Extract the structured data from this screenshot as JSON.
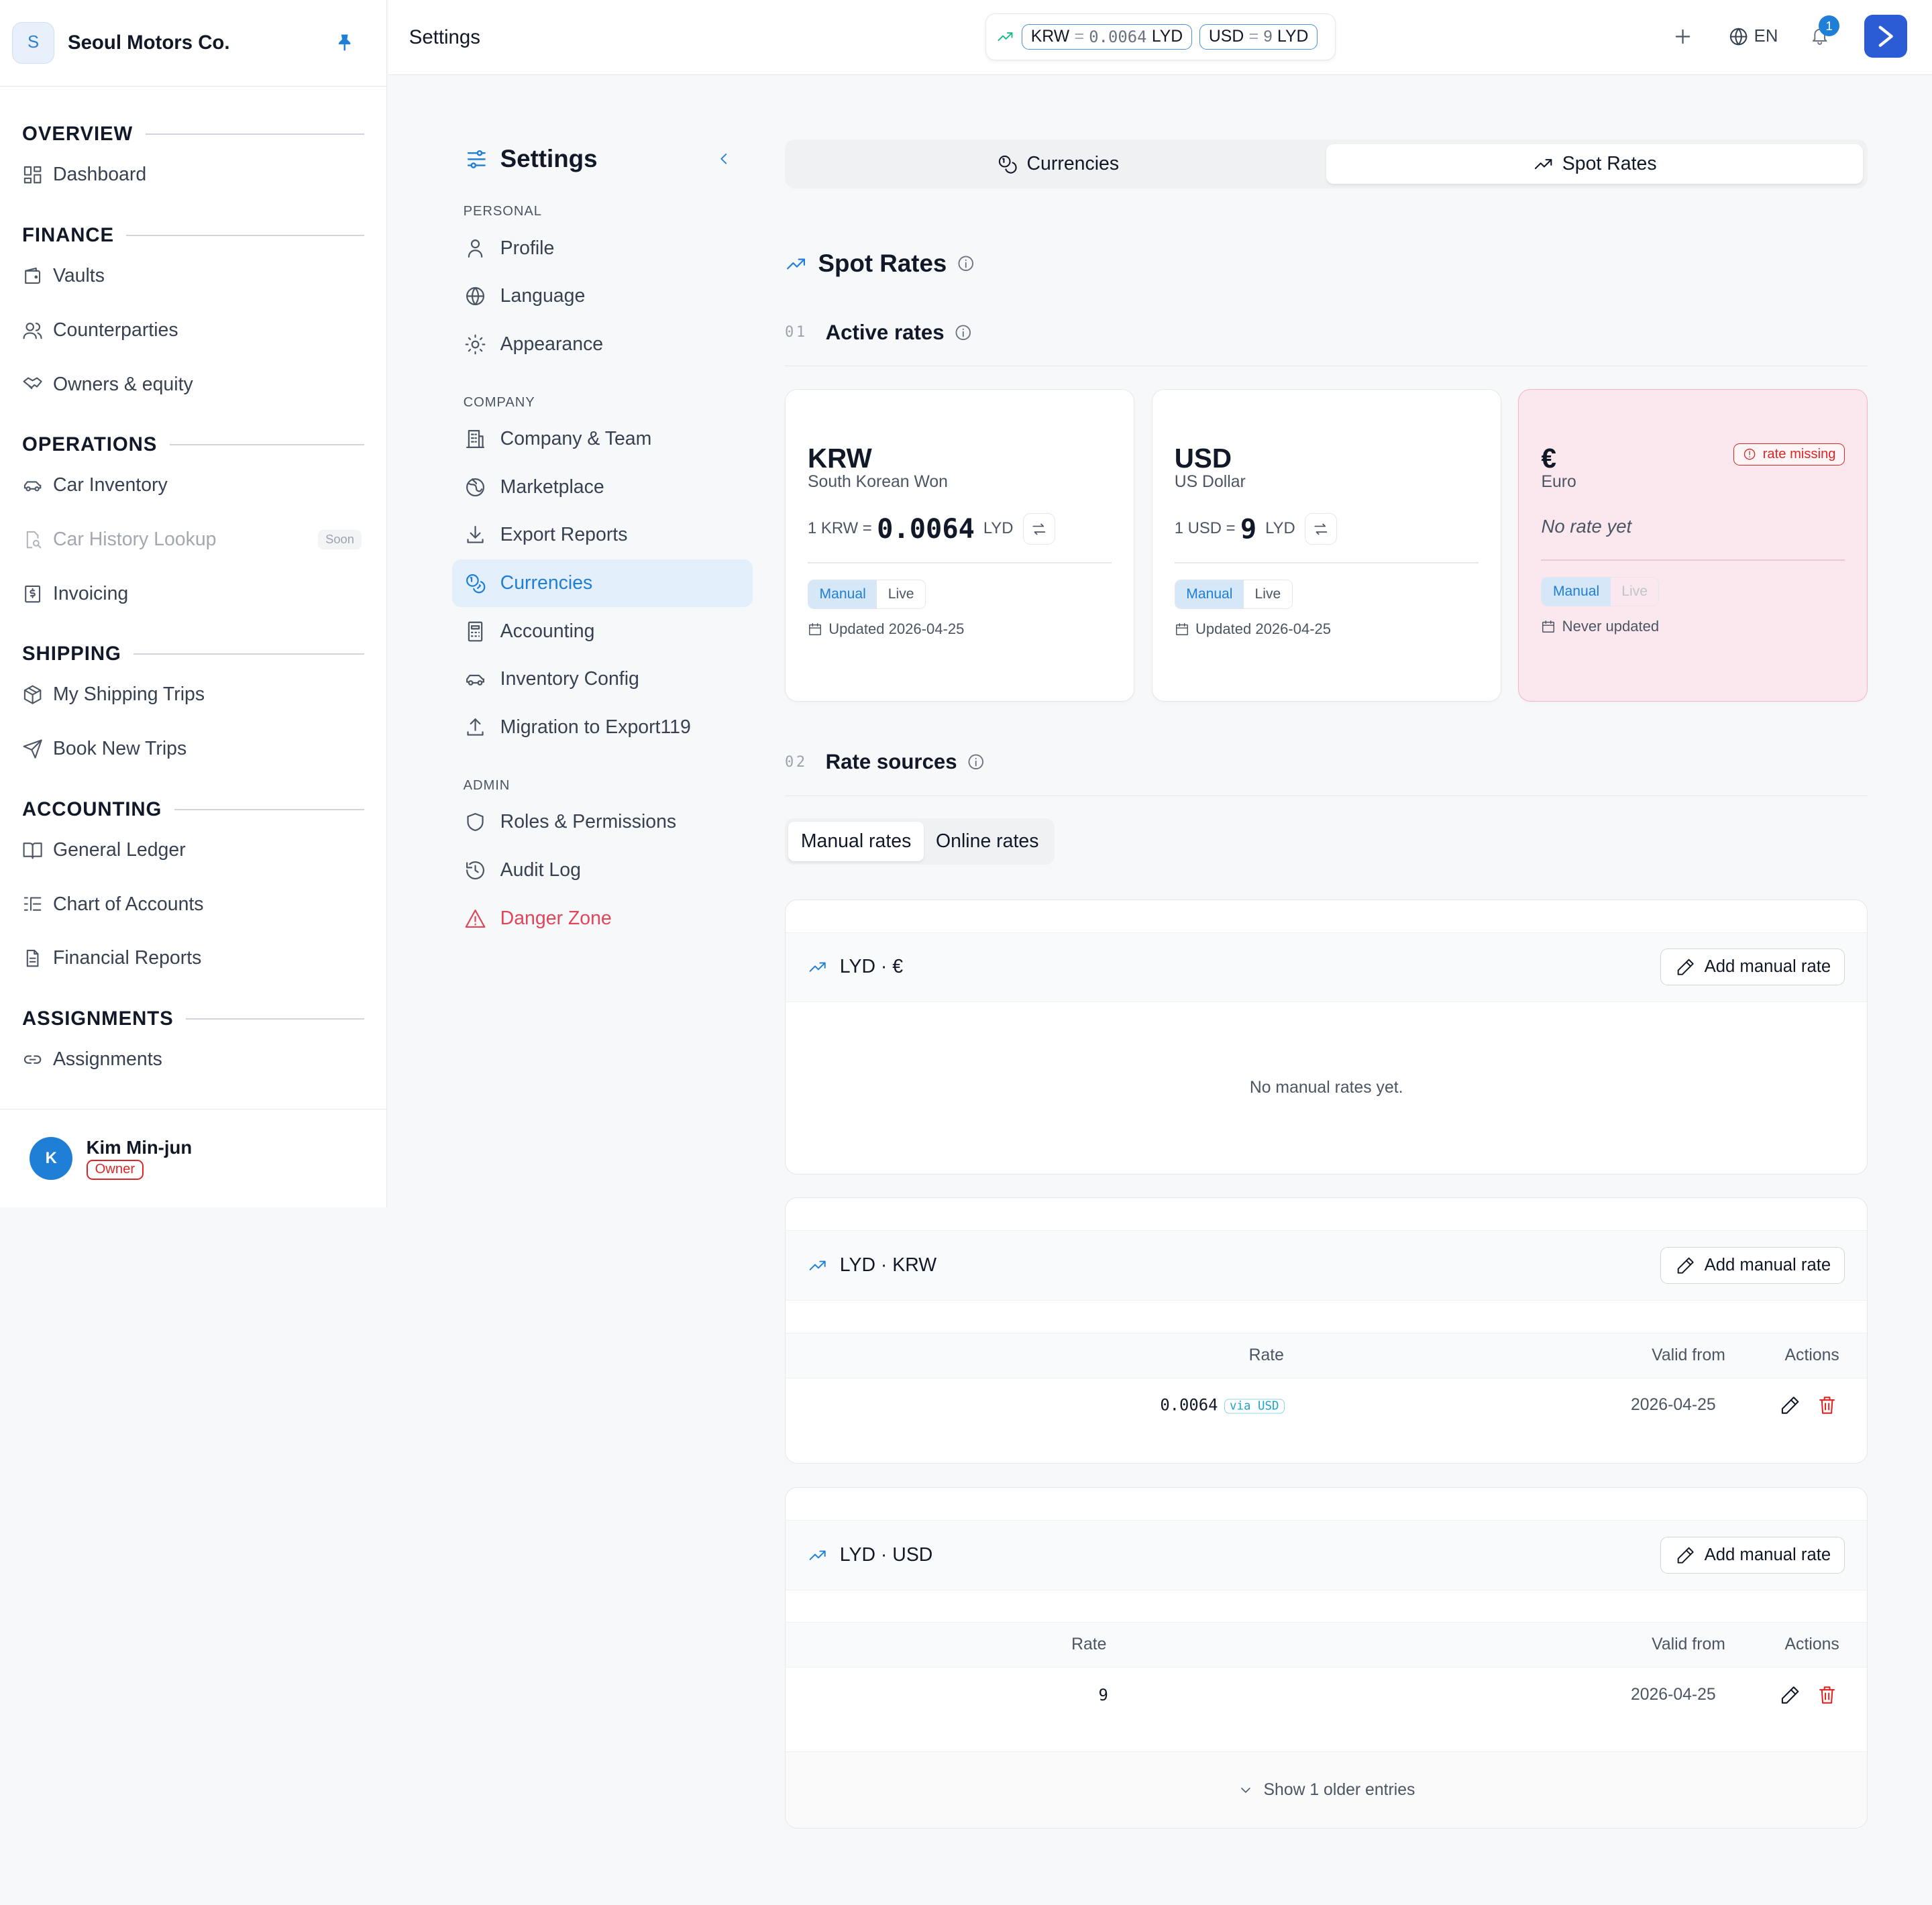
{
  "company": {
    "initial": "S",
    "name": "Seoul Motors Co."
  },
  "sidebar": {
    "sections": [
      {
        "title": "OVERVIEW",
        "items": [
          {
            "label": "Dashboard",
            "icon": "dashboard-icon"
          }
        ]
      },
      {
        "title": "FINANCE",
        "items": [
          {
            "label": "Vaults",
            "icon": "wallet-icon"
          },
          {
            "label": "Counterparties",
            "icon": "users-icon"
          },
          {
            "label": "Owners & equity",
            "icon": "handshake-icon"
          }
        ]
      },
      {
        "title": "OPERATIONS",
        "items": [
          {
            "label": "Car Inventory",
            "icon": "car-icon"
          },
          {
            "label": "Car History Lookup",
            "icon": "search-doc-icon",
            "badge": "Soon"
          },
          {
            "label": "Invoicing",
            "icon": "invoice-icon"
          }
        ]
      },
      {
        "title": "SHIPPING",
        "items": [
          {
            "label": "My Shipping Trips",
            "icon": "box-icon"
          },
          {
            "label": "Book New Trips",
            "icon": "send-icon"
          }
        ]
      },
      {
        "title": "ACCOUNTING",
        "items": [
          {
            "label": "General Ledger",
            "icon": "book-icon"
          },
          {
            "label": "Chart of Accounts",
            "icon": "list-tree-icon"
          },
          {
            "label": "Financial Reports",
            "icon": "file-icon"
          }
        ]
      },
      {
        "title": "ASSIGNMENTS",
        "items": [
          {
            "label": "Assignments",
            "icon": "link-icon"
          }
        ]
      }
    ]
  },
  "user": {
    "initial": "K",
    "name": "Kim Min-jun",
    "role": "Owner"
  },
  "topbar": {
    "title": "Settings",
    "ticker": [
      {
        "code": "KRW",
        "eq": "=",
        "value": "0.0064",
        "quote": "LYD"
      },
      {
        "code": "USD",
        "eq": "=",
        "value": "9",
        "quote": "LYD"
      }
    ],
    "lang": "EN",
    "notifications": "1"
  },
  "settings_nav": {
    "title": "Settings",
    "groups": [
      {
        "title": "PERSONAL",
        "items": [
          {
            "label": "Profile",
            "icon": "user-icon"
          },
          {
            "label": "Language",
            "icon": "globe-icon"
          },
          {
            "label": "Appearance",
            "icon": "sun-icon"
          }
        ]
      },
      {
        "title": "COMPANY",
        "items": [
          {
            "label": "Company & Team",
            "icon": "building-icon"
          },
          {
            "label": "Marketplace",
            "icon": "globe-grid-icon"
          },
          {
            "label": "Export Reports",
            "icon": "download-icon"
          },
          {
            "label": "Currencies",
            "icon": "coins-icon",
            "active": true
          },
          {
            "label": "Accounting",
            "icon": "calculator-icon"
          },
          {
            "label": "Inventory Config",
            "icon": "car-icon"
          },
          {
            "label": "Migration to Export119",
            "icon": "upload-icon"
          }
        ]
      },
      {
        "title": "ADMIN",
        "items": [
          {
            "label": "Roles & Permissions",
            "icon": "shield-icon"
          },
          {
            "label": "Audit Log",
            "icon": "history-icon"
          },
          {
            "label": "Danger Zone",
            "icon": "warning-icon",
            "danger": true
          }
        ]
      }
    ]
  },
  "tabs": {
    "currencies": "Currencies",
    "spot_rates": "Spot Rates"
  },
  "page": {
    "title": "Spot Rates"
  },
  "active_rates": {
    "num": "01",
    "title": "Active rates",
    "cards": [
      {
        "code": "KRW",
        "name": "South Korean Won",
        "pre": "1 KRW =",
        "rate": "0.0064",
        "quote": "LYD",
        "manual": "Manual",
        "live": "Live",
        "updated": "Updated 2026-04-25"
      },
      {
        "code": "USD",
        "name": "US Dollar",
        "pre": "1 USD =",
        "rate": "9",
        "quote": "LYD",
        "manual": "Manual",
        "live": "Live",
        "updated": "Updated 2026-04-25"
      },
      {
        "code": "€",
        "name": "Euro",
        "badge": "rate missing",
        "no_rate": "No rate yet",
        "manual": "Manual",
        "live": "Live",
        "updated": "Never updated"
      }
    ]
  },
  "rate_sources": {
    "num": "02",
    "title": "Rate sources",
    "tabs": {
      "manual": "Manual rates",
      "online": "Online rates"
    },
    "add_label": "Add manual rate",
    "col_rate": "Rate",
    "col_valid": "Valid from",
    "col_actions": "Actions",
    "panels": [
      {
        "pair": "LYD · €",
        "empty": "No manual rates yet."
      },
      {
        "pair": "LYD · KRW",
        "rate": "0.0064",
        "via": "via USD",
        "valid": "2026-04-25"
      },
      {
        "pair": "LYD · USD",
        "rate": "9",
        "valid": "2026-04-25",
        "older": "Show 1 older entries"
      }
    ]
  }
}
